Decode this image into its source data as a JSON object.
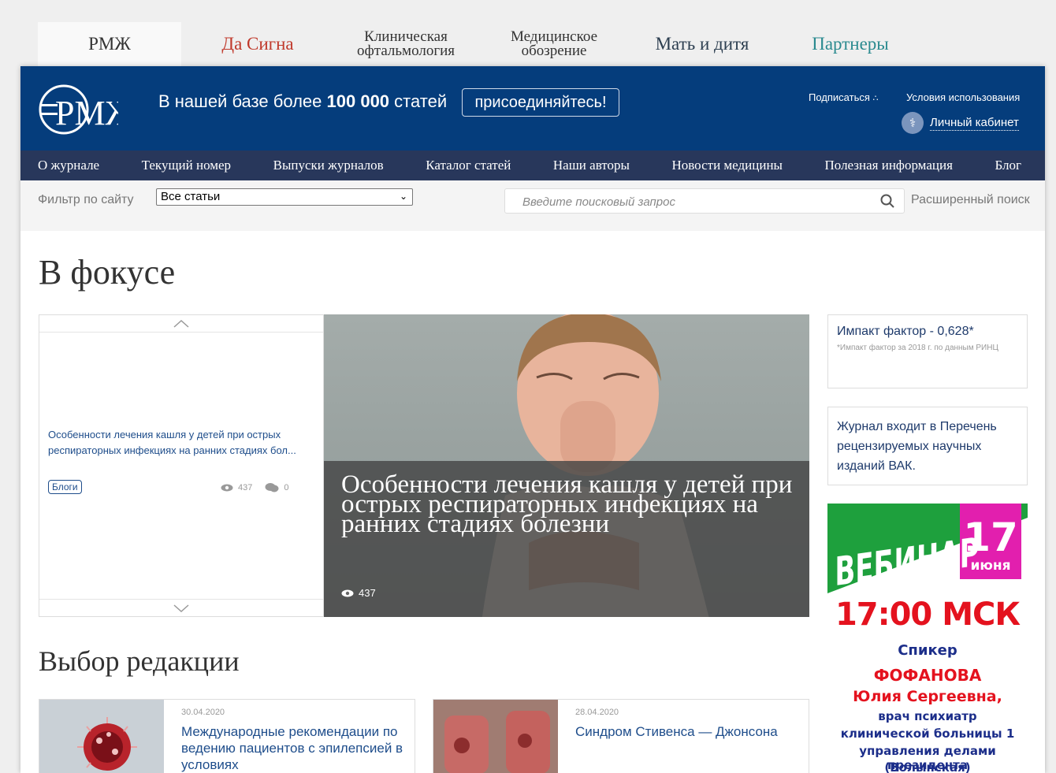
{
  "site_tabs": [
    {
      "label": "РМЖ",
      "color": "#333333"
    },
    {
      "label": "Да Сигна",
      "color": "#c0392b"
    },
    {
      "label": "Клиническая офтальмология",
      "color": "#333333"
    },
    {
      "label": "Медицинское обозрение",
      "color": "#333333"
    },
    {
      "label": "Мать и дитя",
      "color": "#2c3e50"
    },
    {
      "label": "Партнеры",
      "color": "#2a8a8f"
    }
  ],
  "header": {
    "logo_text": "РМЖ",
    "promo_prefix": "В нашей базе более",
    "promo_number": "100 000",
    "promo_suffix": "статей",
    "join_label": "присоединяйтесь!",
    "subscribe_label": "Подписаться",
    "terms_label": "Условия использования",
    "cabinet_label": "Личный кабинет"
  },
  "nav": [
    "О журнале",
    "Текущий номер",
    "Выпуски журналов",
    "Каталог статей",
    "Наши авторы",
    "Новости медицины",
    "Полезная информация",
    "Блог"
  ],
  "filter": {
    "label": "Фильтр по сайту",
    "selected": "Все статьи",
    "search_placeholder": "Введите поисковый запрос",
    "advanced_label": "Расширенный поиск"
  },
  "focus": {
    "heading": "В фокусе",
    "list_item": {
      "text": "Особенности лечения кашля у детей при острых респираторных инфекциях на ранних стадиях бол...",
      "tag": "Блоги",
      "views": "437",
      "comments": "0"
    },
    "feature": {
      "title": "Особенности лечения кашля у детей при острых респираторных инфекциях на ранних стадиях болезни",
      "views": "437"
    }
  },
  "sidebar": {
    "impact_title": "Импакт фактор - 0,628*",
    "impact_note": "*Импакт фактор за 2018 г. по данным РИНЦ",
    "vak_text": "Журнал входит в Перечень рецензируемых научных изданий ВАК.",
    "banner": {
      "word": "ВЕБИНАР",
      "day": "17",
      "month": "июня",
      "time": "17:00 МСК",
      "speaker_label": "Спикер",
      "surname": "ФОФАНОВА",
      "name": "Юлия Сергеевна,",
      "line1": "врач психиатр",
      "line2": "клинической больницы 1",
      "line3": "управления делами президента",
      "line4": "(Волынская)"
    }
  },
  "editors_choice": {
    "heading": "Выбор редакции",
    "cards": [
      {
        "date": "30.04.2020",
        "title": "Международные рекомендации по ведению пациентов с эпилепсией в условиях"
      },
      {
        "date": "28.04.2020",
        "title": "Синдром Стивенса — Джонсона"
      }
    ]
  }
}
